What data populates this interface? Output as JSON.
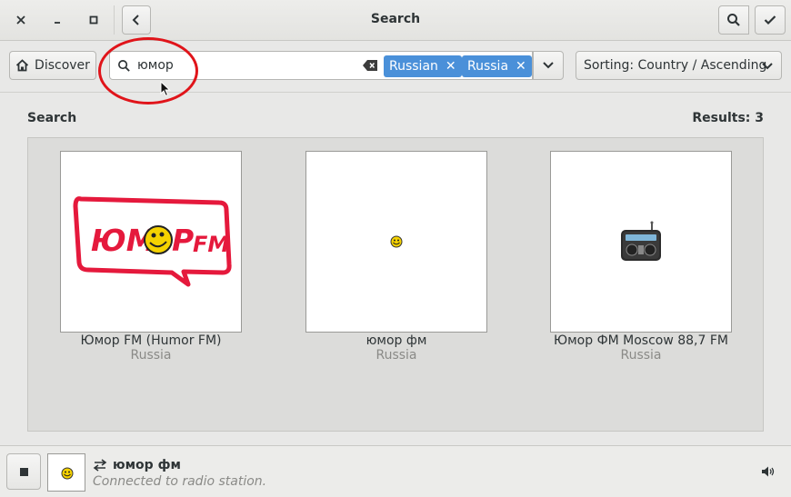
{
  "window": {
    "title": "Search",
    "close_icon": "×",
    "minimize_icon": "–",
    "maximize_icon": "□"
  },
  "header": {
    "back_icon": "chevron-left-icon",
    "search_icon": "search-icon",
    "select_icon": "checkmark-icon"
  },
  "toolbar": {
    "discover_label": "Discover",
    "search_value": "юмор",
    "search_placeholder": "",
    "tags": [
      {
        "label": "Russian"
      },
      {
        "label": "Russia"
      }
    ],
    "sorting_label": "Sorting: Country / Ascending"
  },
  "results": {
    "section_label": "Search",
    "count_label": "Results: 3",
    "items": [
      {
        "name": "Юмор FM (Humor FM)",
        "country": "Russia",
        "logo_text": "ЮМОР FM"
      },
      {
        "name": "юмор фм",
        "country": "Russia"
      },
      {
        "name": "Юмор ФМ Moscow 88,7 FM",
        "country": "Russia"
      }
    ]
  },
  "player": {
    "station_name": "юмор фм",
    "status": "Connected to radio station.",
    "stop_icon": "stop-icon",
    "volume_icon": "volume-icon"
  },
  "colors": {
    "accent": "#4a90d9",
    "highlight_ring": "#e0141a",
    "logo_red": "#e5193c"
  }
}
